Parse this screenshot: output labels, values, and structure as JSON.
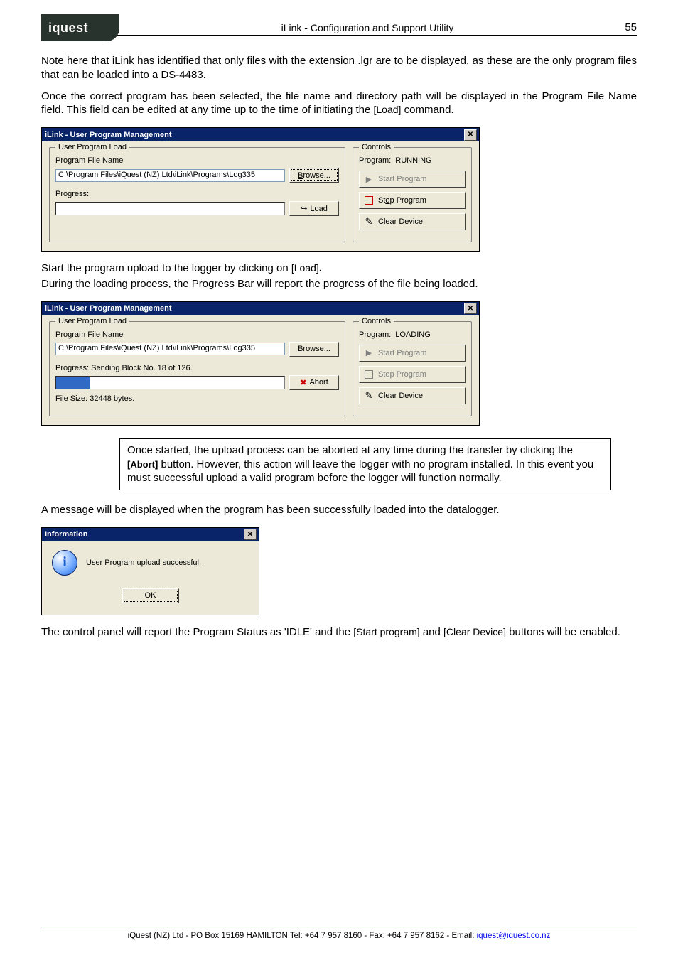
{
  "document": {
    "header_title": "iLink - Configuration and Support Utility",
    "page_number": "55",
    "para1": "Note here that iLink has identified that only files with the extension .lgr are to be displayed, as these are the only program files that can be loaded into a DS-4483.",
    "para2_a": "Once the correct program has been selected, the file name and directory path will be displayed in the Program File Name field.  This field can be edited at any time up to the time of initiating the ",
    "para2_load": "[Load]",
    "para2_b": " command.",
    "para3_a": "Start the program upload to the logger by clicking on ",
    "para3_load": "[Load]",
    "para3_b": ".",
    "para4": "During the loading process, the Progress Bar will report the progress of the file being loaded.",
    "note_a": "Once started, the upload process can be aborted at any time during the transfer by clicking the ",
    "note_abort": "[Abort]",
    "note_b": " button.  However, this action will leave the logger with no program installed.  In this event you must successful upload a valid program before the logger will function normally.",
    "para5": "A message will be displayed when the program has been successfully loaded into the datalogger.",
    "para6_a": "The control panel will report the Program Status as 'IDLE' and the ",
    "para6_start": "[Start program]",
    "para6_mid": " and ",
    "para6_clear": "[Clear Device]",
    "para6_b": " buttons will be enabled."
  },
  "dialog1": {
    "title": "iLink - User Program Management",
    "left_legend": "User Program Load",
    "file_label": "Program File Name",
    "file_path": "C:\\Program Files\\iQuest (NZ) Ltd\\iLink\\Programs\\Log335",
    "browse_hotkey": "B",
    "browse_rest": "rowse...",
    "progress_label": "Progress:",
    "progress_text": "0%",
    "load_hotkey": "L",
    "load_rest": "oad",
    "right_legend": "Controls",
    "program_status_label": "Program:",
    "program_status_value": "RUNNING",
    "start_btn": "Start Program",
    "start_hotkey_rest": "art Program",
    "stop_btn": "Stop Program",
    "stop_hotkey": "o",
    "clear_btn": "Clear Device",
    "clear_hotkey": "C",
    "clear_rest": "lear Device"
  },
  "dialog2": {
    "title": "iLink - User Program Management",
    "left_legend": "User Program Load",
    "file_label": "Program File Name",
    "file_path": "C:\\Program Files\\iQuest (NZ) Ltd\\iLink\\Programs\\Log335",
    "browse_hotkey": "B",
    "browse_rest": "rowse...",
    "progress_label": "Progress: Sending Block No. 18 of 126.",
    "progress_text": "15%",
    "abort_btn": "Abort",
    "filesize": "File Size: 32448 bytes.",
    "right_legend": "Controls",
    "program_status_label": "Program:",
    "program_status_value": "LOADING",
    "start_btn": "Start Program",
    "stop_btn": "Stop Program",
    "clear_btn": "Clear Device",
    "clear_hotkey": "C",
    "clear_rest": "lear Device"
  },
  "dialog3": {
    "title": "Information",
    "message": "User Program upload successful.",
    "ok": "OK"
  },
  "footer": {
    "text_a": "iQuest (NZ) Ltd  -  PO Box 15169 HAMILTON  Tel: +64 7 957 8160 - Fax: +64 7 957 8162 - Email: ",
    "email": "iquest@iquest.co.nz"
  },
  "logo_text": "iquest"
}
